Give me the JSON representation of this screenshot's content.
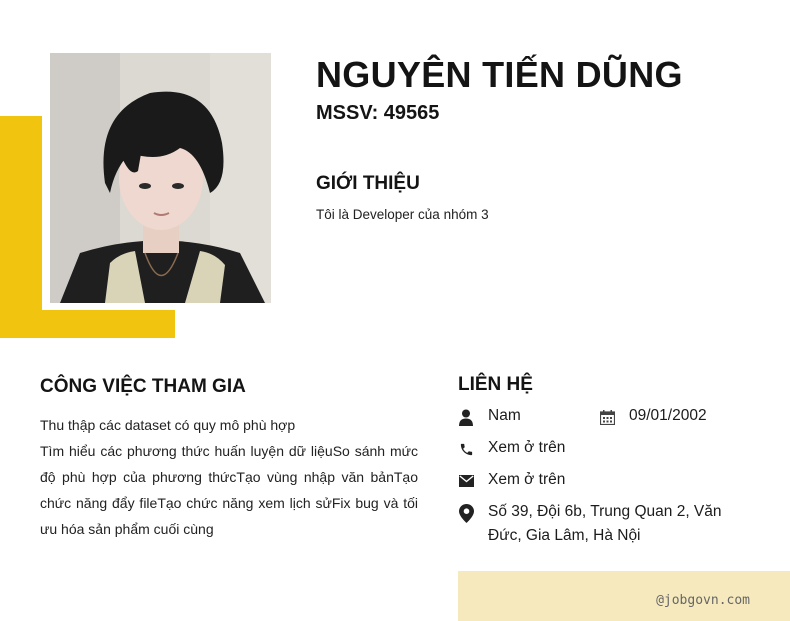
{
  "profile": {
    "name": "NGUYÊN TIẾN DŨNG",
    "mssv": "MSSV: 49565",
    "intro_heading": "GIỚI THIỆU",
    "intro_text": "Tôi là Developer của nhóm 3"
  },
  "work": {
    "heading": "CÔNG VIỆC THAM GIA",
    "items": [
      "Thu thập các dataset có quy mô phù hợp",
      "Tìm hiểu các phương thức huấn luyện dữ liệuSo sánh mức độ phù hợp của phương thứcTạo vùng nhập văn bảnTạo chức năng đẩy fileTạo chức năng xem lịch sửFix bug và tối ưu hóa sản phẩm cuối cùng"
    ]
  },
  "contact": {
    "heading": "LIÊN HỆ",
    "gender": "Nam",
    "dob": "09/01/2002",
    "phone": "Xem ở trên",
    "email": "Xem ở trên",
    "address": "Số 39, Đội 6b, Trung Quan 2, Văn Đức, Gia Lâm, Hà Nội"
  },
  "footer": {
    "watermark": "@jobgovn.com"
  },
  "icons": {
    "gender": "person-icon",
    "dob": "calendar-icon",
    "phone": "phone-icon",
    "email": "envelope-icon",
    "address": "location-pin-icon"
  },
  "colors": {
    "accent": "#f1c40f",
    "footer_bg": "#f5e9bd",
    "text": "#1c1c1c"
  }
}
